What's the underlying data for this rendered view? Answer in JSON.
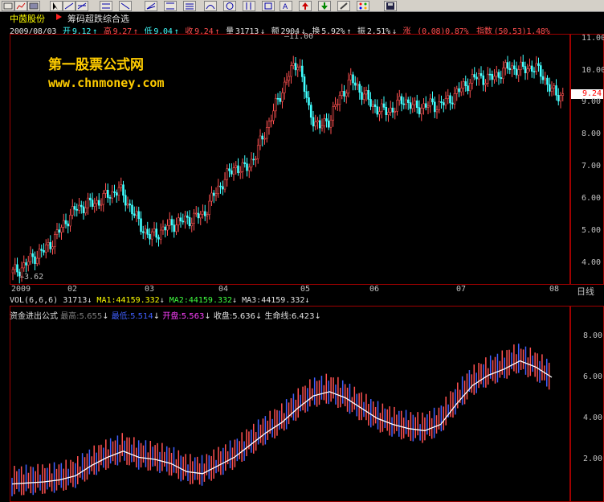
{
  "stock": {
    "name": "中茵股份",
    "formula": "筹码超跌综合选"
  },
  "info": {
    "date": "2009/08/03",
    "open_label": "开",
    "open": "9.12",
    "high_label": "高",
    "high": "9.27",
    "low_label": "低",
    "low": "9.04",
    "close_label": "收",
    "close": "9.24",
    "vol_label": "量",
    "vol": "31713",
    "amount_label": "额",
    "amount": "2904",
    "turnover_label": "换",
    "turnover": "5.92%",
    "amplitude_label": "振",
    "amplitude": "2.51%",
    "change_label": "涨",
    "change": "(0.08)0.87%",
    "index_label": "指数",
    "index": "(50.53)1.48%"
  },
  "watermark": {
    "line1": "第一股票公式网",
    "line2": "www.chnmoney.com"
  },
  "price_axis": [
    "11.00",
    "10.00",
    "9.24",
    "9.00",
    "8.00",
    "7.00",
    "6.00",
    "5.00",
    "4.00"
  ],
  "annotations": {
    "max": "11.00",
    "min": "3.62"
  },
  "dates": [
    "2009",
    "02",
    "03",
    "04",
    "05",
    "06",
    "07",
    "08"
  ],
  "period": "日线",
  "vol_row": {
    "name": "VOL(6,6,6)",
    "vol": "31713",
    "ma1": "MA1:44159.332",
    "ma2": "MA2:44159.332",
    "ma3": "MA3:44159.332"
  },
  "fund_row": {
    "name": "资金进出公式",
    "high": "最高:5.655",
    "low": "最低:5.514",
    "open": "开盘:5.563",
    "close": "收盘:5.636",
    "life": "生命线:6.423"
  },
  "lower_axis": [
    "8.00",
    "6.00",
    "4.00",
    "2.00"
  ],
  "colors": {
    "up": "#ff5050",
    "down": "#40ffff",
    "border": "#a00000",
    "life": "#ffffff"
  }
}
